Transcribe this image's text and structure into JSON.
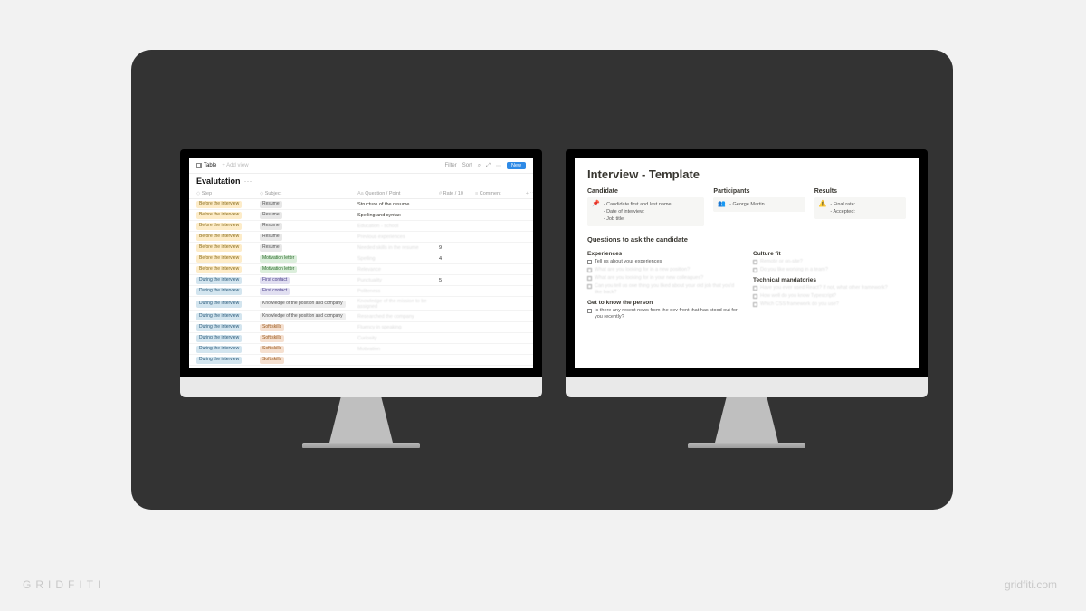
{
  "brand": {
    "name": "GRIDFITI",
    "url": "gridfiti.com"
  },
  "left": {
    "toolbar": {
      "tab": "Table",
      "add_view": "+ Add view",
      "filter": "Filter",
      "sort": "Sort",
      "new": "New"
    },
    "title": "Evalutation",
    "columns": {
      "step": "Step",
      "subject": "Subject",
      "question": "Question / Point",
      "rate": "Rate / 10",
      "comment": "Comment"
    },
    "rows": [
      {
        "step": "Before the interview",
        "step_style": "before",
        "subject": "Resume",
        "subject_style": "resume",
        "question": "Structure of the resume",
        "rate": "",
        "blur": false
      },
      {
        "step": "Before the interview",
        "step_style": "before",
        "subject": "Resume",
        "subject_style": "resume",
        "question": "Spelling and syntax",
        "rate": "",
        "blur": false
      },
      {
        "step": "Before the interview",
        "step_style": "before",
        "subject": "Resume",
        "subject_style": "resume",
        "question": "Education - school",
        "rate": "",
        "blur": true
      },
      {
        "step": "Before the interview",
        "step_style": "before",
        "subject": "Resume",
        "subject_style": "resume",
        "question": "Previous experiences",
        "rate": "",
        "blur": true
      },
      {
        "step": "Before the interview",
        "step_style": "before",
        "subject": "Resume",
        "subject_style": "resume",
        "question": "Needed skills in the resume",
        "rate": "9",
        "blur": true
      },
      {
        "step": "Before the interview",
        "step_style": "before",
        "subject": "Motivation letter",
        "subject_style": "motiv",
        "question": "Spelling",
        "rate": "4",
        "blur": true
      },
      {
        "step": "Before the interview",
        "step_style": "before",
        "subject": "Motivation letter",
        "subject_style": "motiv",
        "question": "Relevance",
        "rate": "",
        "blur": true
      },
      {
        "step": "During the interview",
        "step_style": "during",
        "subject": "First contact",
        "subject_style": "first",
        "question": "Punctuality",
        "rate": "5",
        "blur": true
      },
      {
        "step": "During the interview",
        "step_style": "during",
        "subject": "First contact",
        "subject_style": "first",
        "question": "Politeness",
        "rate": "",
        "blur": true
      },
      {
        "step": "During the interview",
        "step_style": "during",
        "subject": "Knowledge of the position and company",
        "subject_style": "know",
        "question": "Knowledge of the mission to be assigned",
        "rate": "",
        "blur": true
      },
      {
        "step": "During the interview",
        "step_style": "during",
        "subject": "Knowledge of the position and company",
        "subject_style": "know",
        "question": "Researched the company",
        "rate": "",
        "blur": true
      },
      {
        "step": "During the interview",
        "step_style": "during",
        "subject": "Soft skills",
        "subject_style": "soft",
        "question": "Fluency in speaking",
        "rate": "",
        "blur": true
      },
      {
        "step": "During the interview",
        "step_style": "during",
        "subject": "Soft skills",
        "subject_style": "soft",
        "question": "Curiosity",
        "rate": "",
        "blur": true
      },
      {
        "step": "During the interview",
        "step_style": "during",
        "subject": "Soft skills",
        "subject_style": "soft",
        "question": "Motivation",
        "rate": "",
        "blur": true
      },
      {
        "step": "During the interview",
        "step_style": "during",
        "subject": "Soft skills",
        "subject_style": "soft",
        "question": "",
        "rate": "",
        "blur": true
      }
    ]
  },
  "right": {
    "title": "Interview - Template",
    "sections": {
      "candidate": {
        "heading": "Candidate",
        "icon": "📌",
        "lines": [
          "- Candidate first and last name:",
          "- Date of interview:",
          "- Job title:"
        ]
      },
      "participants": {
        "heading": "Participants",
        "icon": "👥",
        "lines": [
          "- George Martin"
        ]
      },
      "results": {
        "heading": "Results",
        "icon": "⚠️",
        "lines": [
          "- Final rate:",
          "- Accepted:"
        ]
      }
    },
    "questions_heading": "Questions to ask the candidate",
    "leftcol": {
      "experiences": {
        "heading": "Experiences",
        "items": [
          {
            "text": "Tell us about your experiences",
            "blur": false
          },
          {
            "text": "What are you looking for in a new position?",
            "blur": true
          },
          {
            "text": "What are you looking for in your new colleagues?",
            "blur": true
          },
          {
            "text": "Can you tell us one thing you liked about your old job that you'd like back?",
            "blur": true
          }
        ]
      },
      "get_to_know": {
        "heading": "Get to know the person",
        "items": [
          {
            "text": "Is there any recent news from the dev front that has stood out for you recently?",
            "blur": false
          }
        ]
      }
    },
    "rightcol": {
      "culture": {
        "heading": "Culture fit",
        "items": [
          {
            "text": "Remote or on-site?",
            "blur": true
          },
          {
            "text": "Do you like working in a team?",
            "blur": true
          }
        ]
      },
      "technical": {
        "heading": "Technical mandatories",
        "items": [
          {
            "text": "Have you ever used React? If not, what other framework?",
            "blur": true
          },
          {
            "text": "How well do you know Typescript?",
            "blur": true
          },
          {
            "text": "Which CSS framework do you use?",
            "blur": true
          }
        ]
      }
    }
  }
}
